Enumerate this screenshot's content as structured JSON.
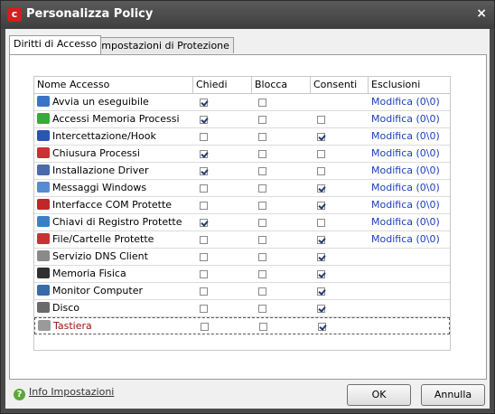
{
  "window": {
    "title": "Personalizza Policy",
    "close": "×",
    "app_letter": "c"
  },
  "tabs": [
    {
      "label": "Diritti di Accesso",
      "active": true
    },
    {
      "label": "Impostazioni di Protezione",
      "active": false
    }
  ],
  "columns": [
    "Nome Accesso",
    "Chiedi",
    "Blocca",
    "Consenti",
    "Esclusioni"
  ],
  "rows": [
    {
      "name": "Avvia un eseguibile",
      "icon": "run-icon",
      "color": "#3b73c6",
      "chiedi": true,
      "blocca": false,
      "consenti": null,
      "link": "Modifica (0\\0)"
    },
    {
      "name": "Accessi Memoria Processi",
      "icon": "memory-process-icon",
      "color": "#3aa83a",
      "chiedi": true,
      "blocca": false,
      "consenti": false,
      "link": "Modifica (0\\0)"
    },
    {
      "name": "Intercettazione/Hook",
      "icon": "hook-icon",
      "color": "#2a55b0",
      "chiedi": false,
      "blocca": false,
      "consenti": true,
      "link": "Modifica (0\\0)"
    },
    {
      "name": "Chiusura Processi",
      "icon": "terminate-process-icon",
      "color": "#c83232",
      "chiedi": true,
      "blocca": false,
      "consenti": false,
      "link": "Modifica (0\\0)"
    },
    {
      "name": "Installazione Driver",
      "icon": "driver-icon",
      "color": "#4a6aa8",
      "chiedi": true,
      "blocca": false,
      "consenti": false,
      "link": "Modifica (0\\0)"
    },
    {
      "name": "Messaggi Windows",
      "icon": "window-messages-icon",
      "color": "#5a8ad0",
      "chiedi": false,
      "blocca": false,
      "consenti": true,
      "link": "Modifica (0\\0)"
    },
    {
      "name": "Interfacce COM Protette",
      "icon": "com-shield-icon",
      "color": "#c02828",
      "chiedi": false,
      "blocca": false,
      "consenti": true,
      "link": "Modifica (0\\0)"
    },
    {
      "name": "Chiavi di Registro Protette",
      "icon": "registry-icon",
      "color": "#3a80c8",
      "chiedi": true,
      "blocca": false,
      "consenti": false,
      "link": "Modifica (0\\0)"
    },
    {
      "name": "File/Cartelle Protette",
      "icon": "protected-file-icon",
      "color": "#c83232",
      "chiedi": false,
      "blocca": false,
      "consenti": true,
      "link": "Modifica (0\\0)"
    },
    {
      "name": "Servizio DNS Client",
      "icon": "dns-icon",
      "color": "#8a8a8a",
      "chiedi": false,
      "blocca": false,
      "consenti": true,
      "link": ""
    },
    {
      "name": "Memoria Fisica",
      "icon": "physical-memory-icon",
      "color": "#303030",
      "chiedi": false,
      "blocca": false,
      "consenti": true,
      "link": ""
    },
    {
      "name": "Monitor Computer",
      "icon": "monitor-icon",
      "color": "#3a6aa8",
      "chiedi": false,
      "blocca": false,
      "consenti": true,
      "link": ""
    },
    {
      "name": "Disco",
      "icon": "disk-icon",
      "color": "#6a6a6a",
      "chiedi": false,
      "blocca": false,
      "consenti": true,
      "link": ""
    },
    {
      "name": "Tastiera",
      "icon": "keyboard-icon",
      "color": "#9a9a9a",
      "chiedi": false,
      "blocca": false,
      "consenti": true,
      "link": "",
      "selected": true
    }
  ],
  "footer": {
    "help_label": "Info Impostazioni",
    "ok_label": "OK",
    "cancel_label": "Annulla"
  }
}
